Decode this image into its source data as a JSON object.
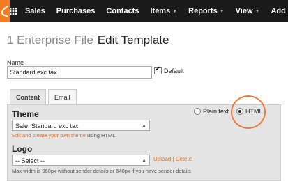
{
  "topbar": {
    "logo_icon": "sage-logo-icon",
    "grid_icon": "apps-grid-icon",
    "nav": [
      {
        "label": "Sales",
        "dropdown": false
      },
      {
        "label": "Purchases",
        "dropdown": false
      },
      {
        "label": "Contacts",
        "dropdown": false
      },
      {
        "label": "Items",
        "dropdown": true
      },
      {
        "label": "Reports",
        "dropdown": true
      },
      {
        "label": "View",
        "dropdown": true
      },
      {
        "label": "Add",
        "dropdown": true
      }
    ]
  },
  "header": {
    "org": "1 Enterprise File",
    "page_title": "Edit Template"
  },
  "form": {
    "name_label": "Name",
    "name_value": "Standard exc tax",
    "default_label": "Default",
    "default_checked": true
  },
  "tabs": [
    {
      "label": "Content",
      "active": true
    },
    {
      "label": "Email",
      "active": false
    }
  ],
  "theme": {
    "heading": "Theme",
    "options": {
      "plain": "Plain text",
      "html": "HTML",
      "selected": "HTML"
    },
    "select_value": "Sale: Standard exc tax",
    "help_link": "Edit and create your own theme",
    "help_suffix": " using HTML."
  },
  "logo": {
    "heading": "Logo",
    "select_value": "-- Select --",
    "upload_label": "Upload",
    "separator": "|",
    "delete_label": "Delete",
    "help": "Max width is 960px without sender details or 640px if you have sender details"
  },
  "colors": {
    "accent_orange": "#f47c20",
    "topbar_bg": "#1a1a1a",
    "highlight_circle": "#f07a3a"
  }
}
